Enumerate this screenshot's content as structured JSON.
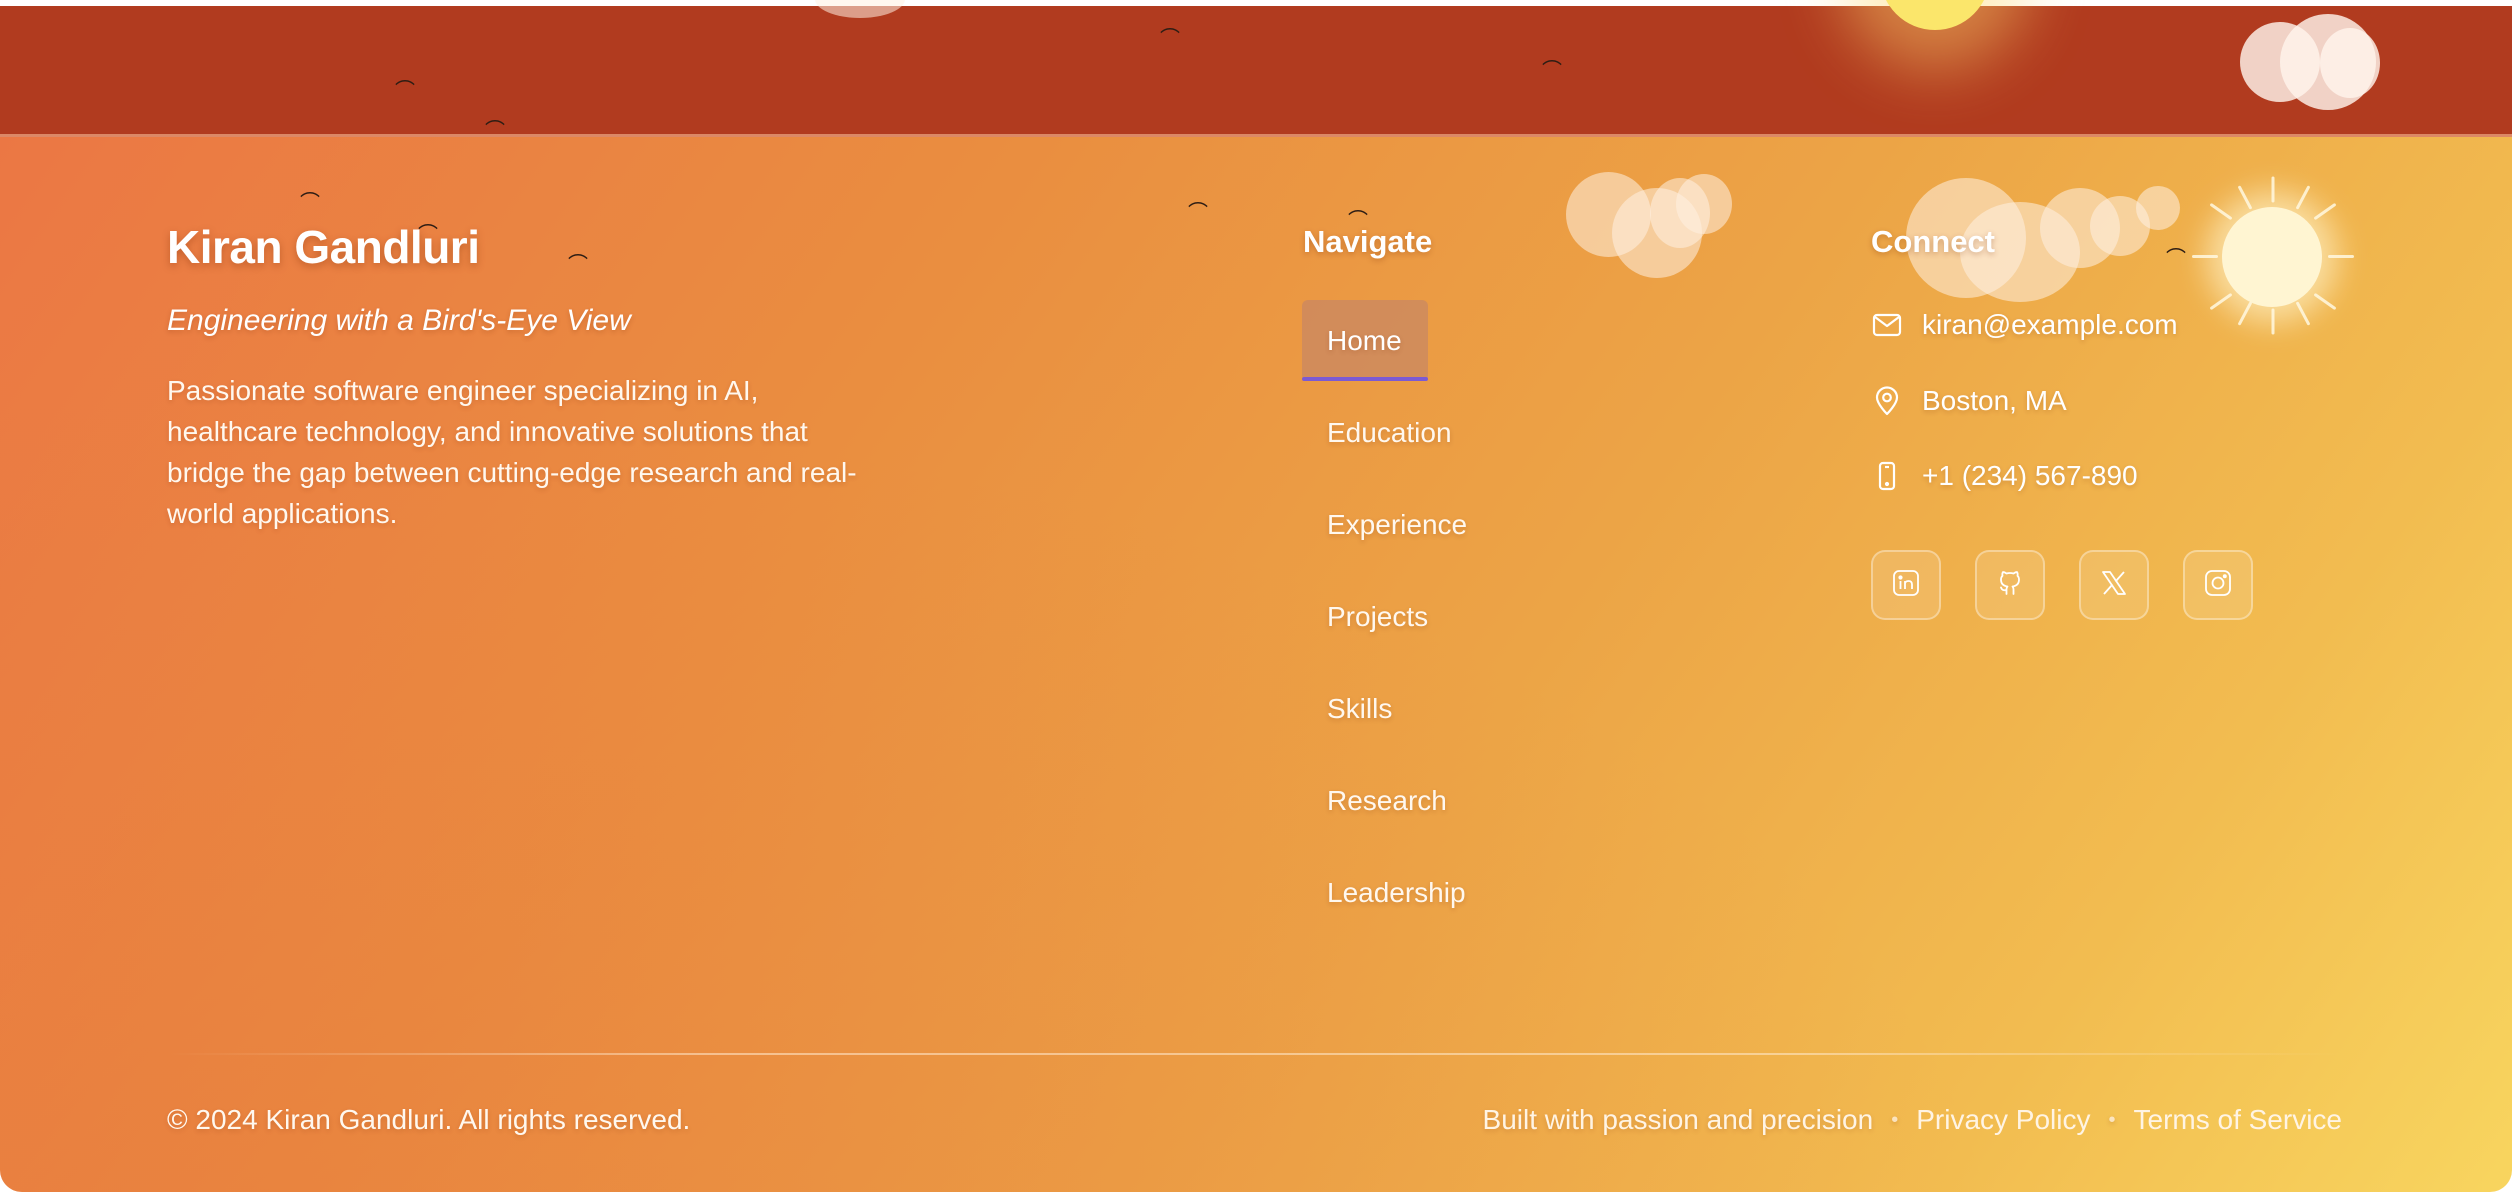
{
  "brand": {
    "name": "Kiran Gandluri",
    "tagline": "Engineering with a Bird's-Eye View",
    "bio": "Passionate software engineer specializing in AI, healthcare technology, and innovative solutions that bridge the gap between cutting-edge research and real-world applications."
  },
  "navigate": {
    "heading": "Navigate",
    "items": [
      {
        "label": "Home",
        "active": true
      },
      {
        "label": "Education"
      },
      {
        "label": "Experience"
      },
      {
        "label": "Projects"
      },
      {
        "label": "Skills"
      },
      {
        "label": "Research"
      },
      {
        "label": "Leadership"
      }
    ]
  },
  "connect": {
    "heading": "Connect",
    "email": {
      "icon": "mail-icon",
      "text": "kiran@example.com"
    },
    "location": {
      "icon": "map-pin-icon",
      "text": "Boston, MA"
    },
    "phone": {
      "icon": "phone-icon",
      "text": "+1 (234) 567-890"
    },
    "social": [
      {
        "name": "linkedin",
        "icon": "linkedin-icon"
      },
      {
        "name": "github",
        "icon": "github-icon"
      },
      {
        "name": "x",
        "icon": "x-icon"
      },
      {
        "name": "instagram",
        "icon": "instagram-icon"
      }
    ]
  },
  "bottom": {
    "copyright": "© 2024 Kiran Gandluri. All rights reserved.",
    "built_with": "Built with passion and precision",
    "privacy": "Privacy Policy",
    "terms": "Terms of Service"
  },
  "colors": {
    "top_band": "#b13b1f",
    "gradient_start": "#eb7744",
    "gradient_end": "#f8d55f",
    "active_underline": "#7b5ad3"
  }
}
